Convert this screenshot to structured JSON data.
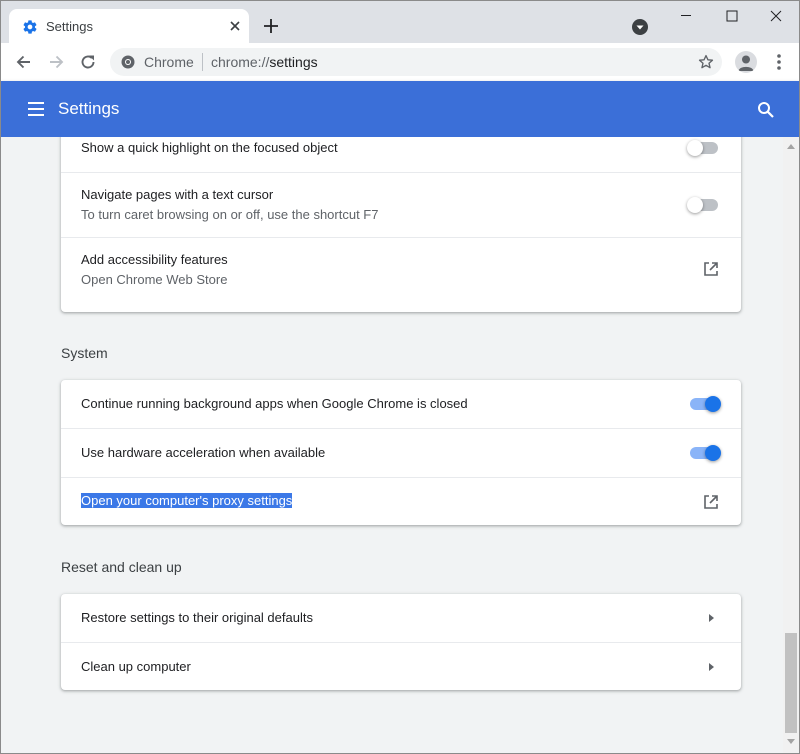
{
  "window": {
    "tab_title": "Settings",
    "minimize_icon": "minimize-icon",
    "maximize_icon": "maximize-icon",
    "close_icon": "close-icon"
  },
  "toolbar": {
    "origin": "Chrome",
    "url_scheme": "chrome://",
    "url_path": "settings"
  },
  "header": {
    "title": "Settings"
  },
  "accessibility_card": {
    "rows": [
      {
        "title": "Show a quick highlight on the focused object",
        "toggle": "off"
      },
      {
        "title": "Navigate pages with a text cursor",
        "subtitle": "To turn caret browsing on or off, use the shortcut F7",
        "toggle": "off"
      },
      {
        "title": "Add accessibility features",
        "subtitle": "Open Chrome Web Store",
        "icon": "open-in-new-icon"
      }
    ]
  },
  "system": {
    "section_title": "System",
    "rows": [
      {
        "title": "Continue running background apps when Google Chrome is closed",
        "toggle": "on"
      },
      {
        "title": "Use hardware acceleration when available",
        "toggle": "on"
      },
      {
        "title": "Open your computer's proxy settings",
        "icon": "open-in-new-icon",
        "selected": true
      }
    ]
  },
  "reset": {
    "section_title": "Reset and clean up",
    "rows": [
      {
        "title": "Restore settings to their original defaults",
        "icon": "arrow-right-icon"
      },
      {
        "title": "Clean up computer",
        "icon": "arrow-right-icon"
      }
    ]
  },
  "colors": {
    "header_blue": "#3b6fd8",
    "toggle_on": "#1a73e8",
    "selection": "#3b78e7"
  }
}
